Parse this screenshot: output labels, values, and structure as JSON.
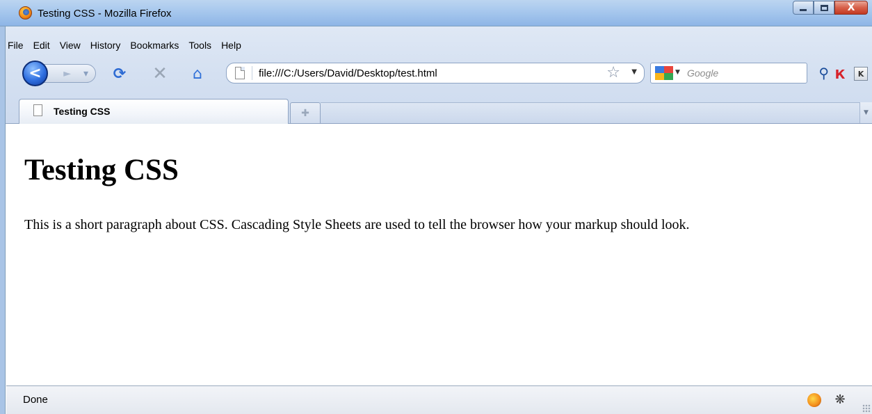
{
  "window": {
    "title": "Testing CSS - Mozilla Firefox",
    "close_glyph": "X"
  },
  "menu": {
    "items": [
      "File",
      "Edit",
      "View",
      "History",
      "Bookmarks",
      "Tools",
      "Help"
    ]
  },
  "navigation": {
    "back_glyph": "<",
    "url": "file:///C:/Users/David/Desktop/test.html",
    "search_placeholder": "Google"
  },
  "extensions": {
    "k_label": "K"
  },
  "tabs": [
    {
      "label": "Testing CSS",
      "active": true
    }
  ],
  "page": {
    "heading": "Testing CSS",
    "paragraph": "This is a short paragraph about CSS. Cascading Style Sheets are used to tell the browser how your markup should look."
  },
  "status": {
    "text": "Done"
  },
  "colors": {
    "titlebar": "#a9c9ee",
    "accent_blue": "#2f6fe0",
    "close_red": "#c33a22"
  }
}
